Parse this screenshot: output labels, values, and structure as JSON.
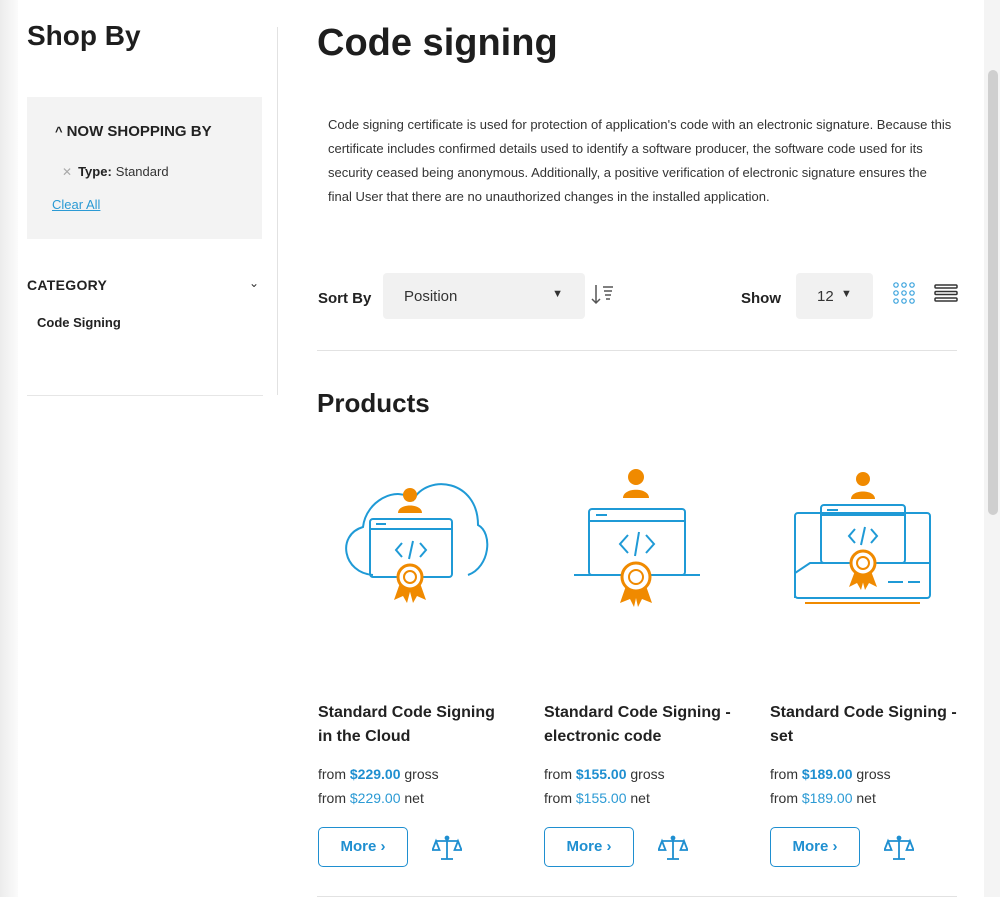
{
  "sidebar": {
    "title": "Shop By",
    "now_shopping": {
      "title": "NOW SHOPPING BY",
      "filters": [
        {
          "label": "Type:",
          "value": "Standard"
        }
      ],
      "clear_all": "Clear All"
    },
    "category": {
      "title": "CATEGORY",
      "items": [
        "Code Signing"
      ]
    }
  },
  "main": {
    "title": "Code signing",
    "description": "Code signing certificate is used for protection of application's code with an electronic signature. Because this certificate includes confirmed details used to identify a software producer, the software code used for its security ceased being anonymous. Additionally, a positive verification of electronic signature ensures the final User that there are no unauthorized changes in the installed application.",
    "toolbar": {
      "sort_label": "Sort By",
      "sort_value": "Position",
      "show_label": "Show",
      "limit_value": "12"
    },
    "products_heading": "Products",
    "products": [
      {
        "name": "Standard Code Signing in the Cloud",
        "from_label": "from",
        "gross_price": "$229.00",
        "gross_label": "gross",
        "net_price": "$229.00",
        "net_label": "net",
        "more_label": "More ›",
        "image": "cloud-code-certificate-icon"
      },
      {
        "name": "Standard Code Signing - electronic code",
        "from_label": "from",
        "gross_price": "$155.00",
        "gross_label": "gross",
        "net_price": "$155.00",
        "net_label": "net",
        "more_label": "More ›",
        "image": "window-code-certificate-icon"
      },
      {
        "name": "Standard Code Signing - set",
        "from_label": "from",
        "gross_price": "$189.00",
        "gross_label": "gross",
        "net_price": "$189.00",
        "net_label": "net",
        "more_label": "More ›",
        "image": "card-code-certificate-icon"
      }
    ]
  },
  "colors": {
    "accent_blue": "#1f8fd0",
    "accent_orange": "#f08a00",
    "panel_gray": "#f3f3f3"
  }
}
